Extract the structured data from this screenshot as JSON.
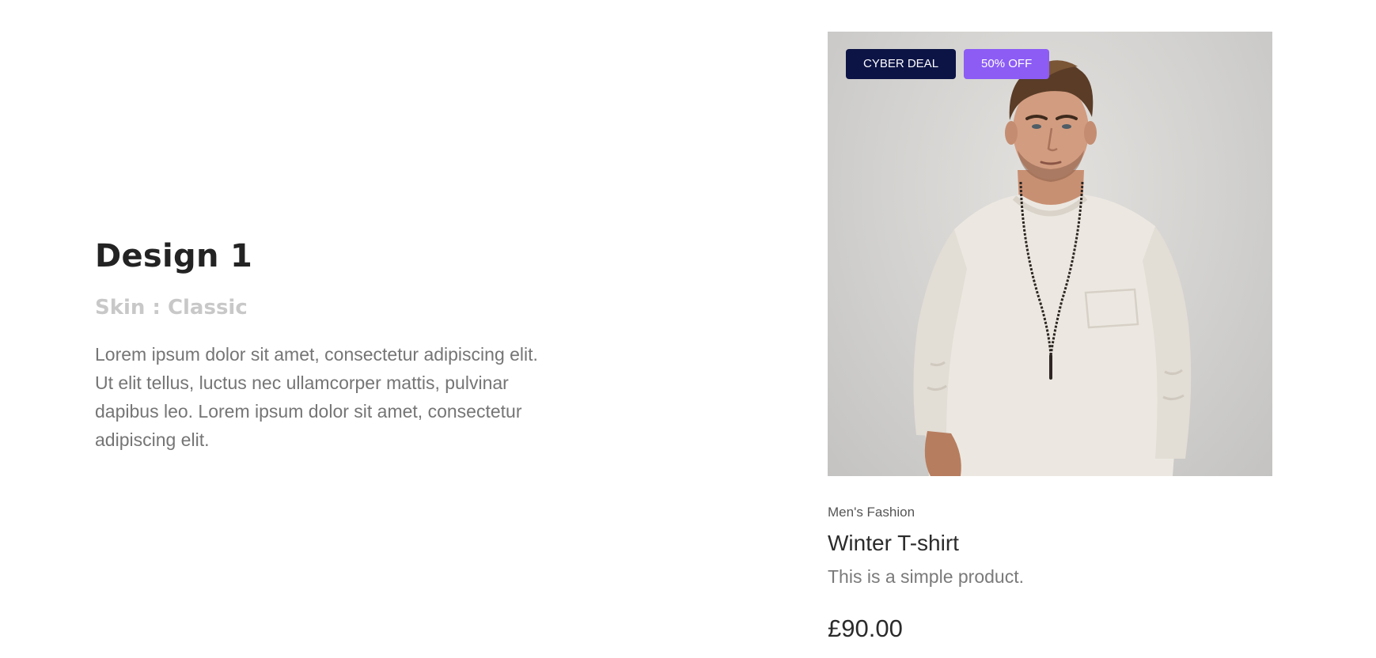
{
  "intro": {
    "title": "Design 1",
    "skin": "Skin : Classic",
    "description": "Lorem ipsum dolor sit amet, consectetur adipiscing elit. Ut elit tellus, luctus nec ullamcorper mattis, pulvinar dapibus leo. Lorem ipsum dolor sit amet, consectetur adipiscing elit."
  },
  "product": {
    "badges": {
      "cyber_deal": "CYBER DEAL",
      "discount": "50% OFF"
    },
    "category": "Men's Fashion",
    "name": "Winter T-shirt",
    "description": "This is a simple product.",
    "price": "£90.00"
  },
  "colors": {
    "cyber_badge": "#0c1446",
    "discount_badge": "#8c5cf5",
    "title_text": "#232323",
    "muted_text": "#c8c8c8",
    "body_text": "#757575"
  }
}
